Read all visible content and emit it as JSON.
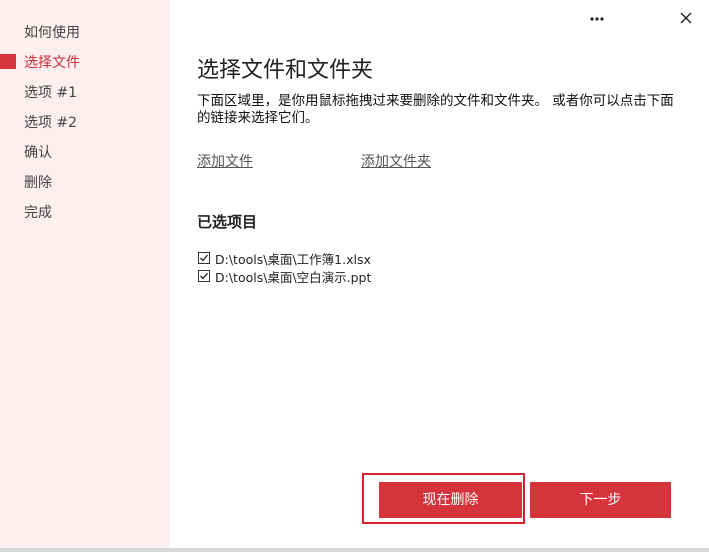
{
  "sidebar": {
    "items": [
      {
        "label": "如何使用"
      },
      {
        "label": "选择文件"
      },
      {
        "label": "选项 #1"
      },
      {
        "label": "选项 #2"
      },
      {
        "label": "确认"
      },
      {
        "label": "删除"
      },
      {
        "label": "完成"
      }
    ],
    "active_index": 1
  },
  "topbar": {
    "more_icon": "more-horizontal-icon",
    "close_icon": "close-icon"
  },
  "main": {
    "title": "选择文件和文件夹",
    "description": "下面区域里，是你用鼠标拖拽过来要删除的文件和文件夹。 或者你可以点击下面的链接来选择它们。",
    "add_file_link": "添加文件",
    "add_folder_link": "添加文件夹",
    "selected_title": "已选项目",
    "files": [
      {
        "path": "D:\\tools\\桌面\\工作簿1.xlsx",
        "checked": true
      },
      {
        "path": "D:\\tools\\桌面\\空白演示.ppt",
        "checked": true
      }
    ]
  },
  "buttons": {
    "delete_now": "现在删除",
    "next": "下一步"
  },
  "colors": {
    "accent": "#d6343c",
    "sidebar_bg": "#fdeff0",
    "highlight": "#d6202a"
  }
}
